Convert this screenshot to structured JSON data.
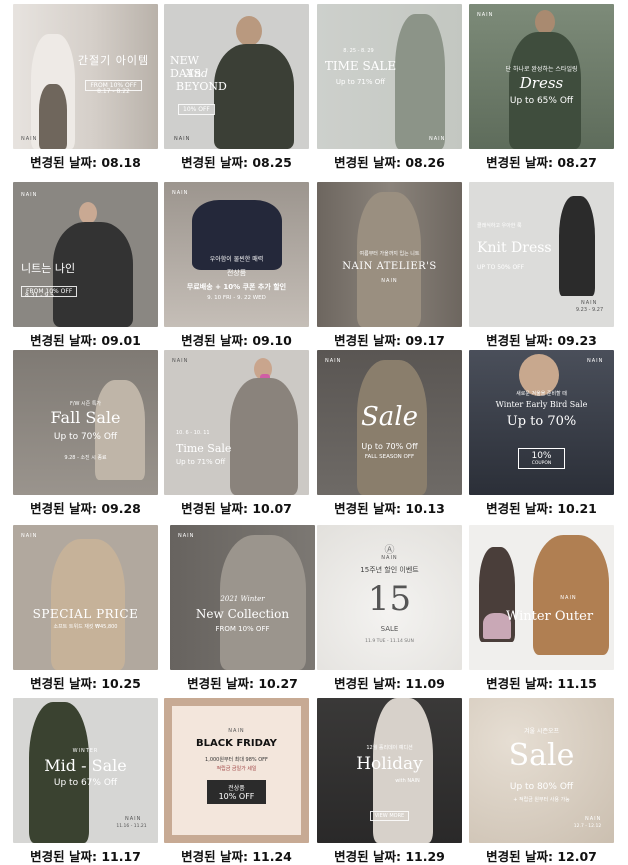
{
  "caption_prefix": "변경된 날짜:",
  "banners": [
    {
      "date": "08.18",
      "brand": "NAIN",
      "title": "간절기 아이템",
      "sub": "FROM 10% OFF",
      "sub2": "8.17 - 8.22",
      "bg": "#d9d4cf"
    },
    {
      "date": "08.25",
      "brand": "NAIN",
      "title": "NEW DAYS",
      "title2": "And",
      "title3": "BEYOND",
      "sub": "10% OFF",
      "bg": "#cfcfcd"
    },
    {
      "date": "08.26",
      "brand": "NAIN",
      "pre": "8. 25 - 8. 29",
      "title": "TIME SALE",
      "sub": "Up to 71% Off",
      "bg": "#c7cbc6"
    },
    {
      "date": "08.27",
      "brand": "NAIN",
      "pre": "단 하나로 완성하는 스타일링",
      "title": "Dress",
      "sub": "Up to 65% Off",
      "bg": "#6d7d6a"
    },
    {
      "date": "09.01",
      "brand": "NAIN",
      "title": "니트는 나인",
      "sub": "FROM 10% OFF",
      "sub2": "8.31 - 9.5",
      "bg": "#8a8782"
    },
    {
      "date": "09.10",
      "brand": "NAIN",
      "pre": "우아함이 물씬한 매력",
      "pre2": "전상품",
      "title": "무료배송 + 10% 쿠폰 추가 할인",
      "sub": "9. 10 FRI - 9. 22 WED",
      "bg": "#b8b2ad"
    },
    {
      "date": "09.17",
      "brand": "NAIN",
      "pre": "여름부터 가을까지 입는 니트",
      "title": "NAIN ATELIER'S",
      "sub": "NAIN",
      "bg": "#7e7770"
    },
    {
      "date": "09.23",
      "brand": "NAIN",
      "pre": "클래식하고 우아한 룩",
      "title": "Knit Dress",
      "sub": "UP TO 50% OFF",
      "sub2": "9.23 - 9.27",
      "bg": "#d9d9d7"
    },
    {
      "date": "09.28",
      "brand": "NAIN",
      "pre": "F/W 시즌 특가",
      "title": "Fall Sale",
      "sub": "Up to 70% Off",
      "sub2": "9.28 - 소진 시 종료",
      "bg": "#8c8782"
    },
    {
      "date": "10.07",
      "brand": "NAIN",
      "pre": "10. 6 - 10. 11",
      "title": "Time Sale",
      "sub": "Up to 71% Off",
      "bg": "#c9c6c2"
    },
    {
      "date": "10.13",
      "brand": "NAIN",
      "title": "Sale",
      "sub": "Up to 70% Off",
      "sub2": "FALL SEASON OFF",
      "bg": "#5e5a57"
    },
    {
      "date": "10.21",
      "brand": "NAIN",
      "pre": "새로운 겨울을 준비할 때",
      "title": "Winter Early Bird Sale",
      "sub": "Up to 70%",
      "sub2": "10%",
      "sub3": "COUPON",
      "bg": "#3a3f4a"
    },
    {
      "date": "10.25",
      "brand": "NAIN",
      "title": "SPECIAL PRICE",
      "sub": "소프트 트위드 재킷 ₩45,800",
      "bg": "#b1a89e"
    },
    {
      "date": "10.27",
      "brand": "NAIN",
      "pre": "2021 Winter",
      "title": "New Collection",
      "sub": "FROM 10% OFF",
      "bg": "#6e6a66"
    },
    {
      "date": "11.09",
      "brand": "NAIN",
      "pre": "15주년 할인 이벤트",
      "title": "15",
      "sub": "SALE",
      "sub2": "11.9 TUE - 11.14 SUN",
      "bg": "#ececea"
    },
    {
      "date": "11.15",
      "brand": "NAIN",
      "title": "Winter Outer",
      "bg": "#efeeec"
    },
    {
      "date": "11.17",
      "brand": "NAIN",
      "pre": "WINTER",
      "title": "Mid - Sale",
      "sub": "Up to 67% Off",
      "sub2": "11.16 - 11.21",
      "bg": "#d6d6d4"
    },
    {
      "date": "11.24",
      "brand": "NAIN",
      "title": "BLACK FRIDAY",
      "sub": "1,000원부터 최대 98% OFF",
      "sub2": "적립금 금일가 세일",
      "sub3": "전상품",
      "sub4": "10% OFF",
      "bg": "#e6d3c6"
    },
    {
      "date": "11.29",
      "brand": "NAIN",
      "pre": "12월 홀리데이 예디션",
      "title": "Holiday",
      "sub": "with NAIN",
      "sub2": "VIEW MORE",
      "bg": "#3c3b3b"
    },
    {
      "date": "12.07",
      "brand": "NAIN",
      "pre": "겨울 시즌오프",
      "title": "Sale",
      "sub": "Up to 80% Off",
      "sub2": "+ 적립금 원부터 사용 가능",
      "sub3": "12.7 - 12.12",
      "bg": "#d9cfc2"
    }
  ]
}
